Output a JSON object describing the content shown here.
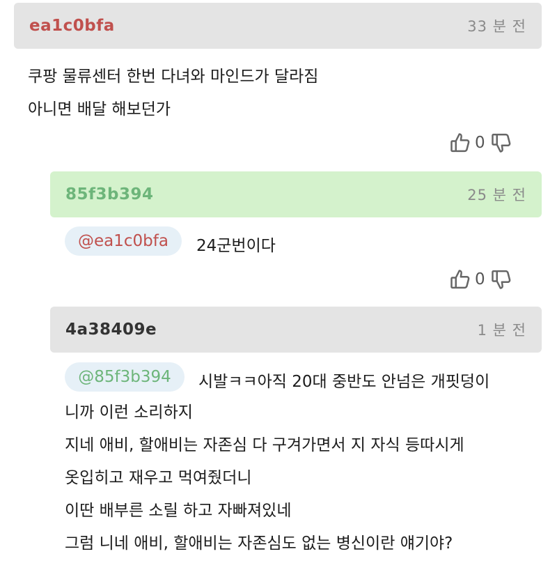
{
  "comments": [
    {
      "username": "ea1c0bfa",
      "time": "33 분 전",
      "username_color": "#c0504d",
      "header_color": "#e4e4e4",
      "lines": [
        "쿠팡 물류센터 한번 다녀와 마인드가 달라짐",
        "아니면 배달 해보던가"
      ],
      "likes": "0"
    },
    {
      "username": "85f3b394",
      "time": "25 분 전",
      "username_color": "#6db57a",
      "header_color": "#d4f2cc",
      "mention": "@ea1c0bfa",
      "mention_color": "#c0504d",
      "lines": [
        "24군번이다"
      ],
      "likes": "0"
    },
    {
      "username": "4a38409e",
      "time": "1 분 전",
      "username_color": "#333333",
      "header_color": "#e4e4e4",
      "mention": "@85f3b394",
      "mention_color": "#6db57a",
      "lines": [
        "시발ㅋㅋ아직 20대 중반도 안넘은 개핏덩이",
        "니까 이런 소리하지",
        "지네 애비, 할애비는 자존심 다 구겨가면서 지 자식 등따시게",
        "옷입히고 재우고 먹여줬더니",
        "이딴 배부른 소릴 하고 자빠져있네",
        "그럼 니네 애비, 할애비는 자존심도 없는 병신이란 얘기야?"
      ]
    }
  ],
  "icons": {
    "like": "thumbs-up-icon",
    "dislike": "thumbs-down-icon"
  }
}
